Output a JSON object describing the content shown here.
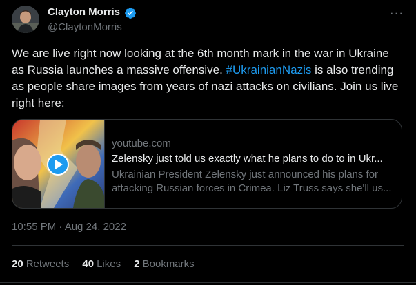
{
  "author": {
    "display_name": "Clayton Morris",
    "handle": "@ClaytonMorris"
  },
  "tweet": {
    "text_before": "We are live right now looking at the 6th month mark in the war in Ukraine as Russia launches a massive offensive. ",
    "hashtag": "#UkrainianNazis",
    "text_after": " is also trending as people share images from years of nazi attacks on civilians. Join us live right here:",
    "timestamp": "10:55 PM · Aug 24, 2022"
  },
  "card": {
    "domain": "youtube.com",
    "title": "Zelensky just told us exactly what he plans to do to in Ukr...",
    "desc_line1": "Ukrainian President Zelensky just announced his plans for",
    "desc_line2": "attacking Russian forces in Crimea. Liz Truss says she'll us..."
  },
  "stats": {
    "retweets_count": "20",
    "retweets_label": "Retweets",
    "likes_count": "40",
    "likes_label": "Likes",
    "bookmarks_count": "2",
    "bookmarks_label": "Bookmarks"
  },
  "colors": {
    "accent": "#1d9bf0",
    "background": "#000000",
    "text": "#e7e9ea",
    "muted": "#71767b"
  },
  "icons": [
    "verified-badge-icon",
    "more-options-icon",
    "play-icon"
  ]
}
